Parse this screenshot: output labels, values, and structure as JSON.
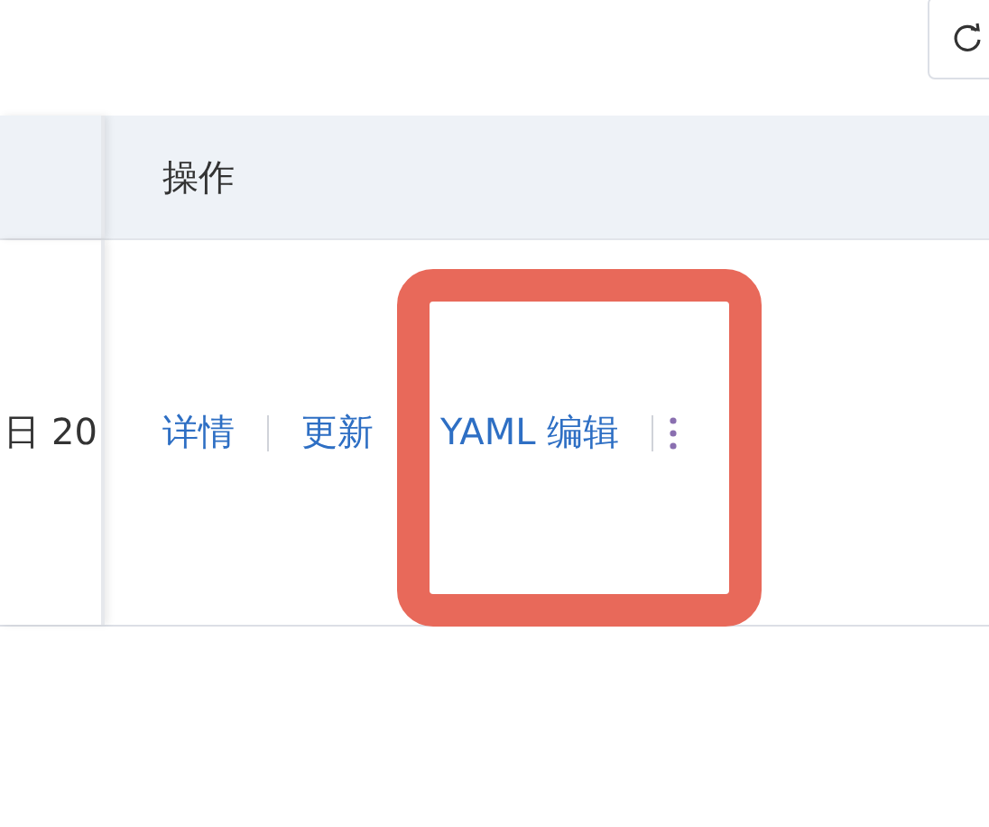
{
  "table": {
    "header": "操作",
    "row": {
      "date_cell": "日 20",
      "actions": [
        "详情",
        "更新",
        "YAML 编辑"
      ]
    }
  },
  "highlight": {
    "kind": "rounded-box",
    "color": "#e8695a"
  }
}
